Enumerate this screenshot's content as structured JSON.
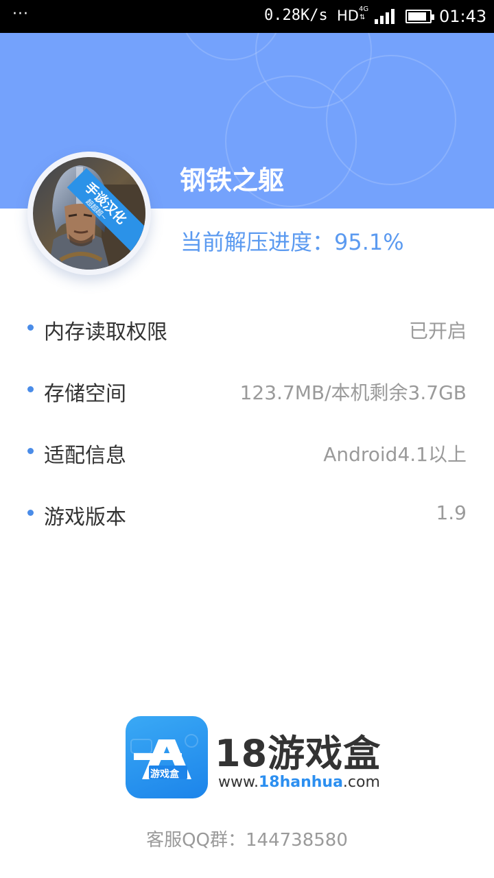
{
  "status_bar": {
    "menu": "···",
    "speed": "0.28K/s",
    "hd": "HD",
    "network": "4G",
    "net_arrows": "⇅",
    "battery_level": 0.85,
    "time": "01:43"
  },
  "header": {
    "title": "钢铁之躯",
    "progress_label": "当前解压进度：",
    "progress_value": "95.1%",
    "progress_fraction": 0.951
  },
  "avatar": {
    "badge_text": "手谈汉化",
    "badge_sub": "超超超~"
  },
  "info": [
    {
      "label": "内存读取权限",
      "value": "已开启"
    },
    {
      "label": "存储空间",
      "value": "123.7MB/本机剩余3.7GB"
    },
    {
      "label": "适配信息",
      "value": "Android4.1以上"
    },
    {
      "label": "游戏版本",
      "value": "1.9"
    }
  ],
  "brand": {
    "tile_text": "游戏盒",
    "name": "18游戏盒",
    "url_prefix": "www.",
    "url_domain": "18hanhua",
    "url_suffix": ".com"
  },
  "footer": {
    "qq_label": "客服QQ群：",
    "qq_number": "144738580"
  },
  "colors": {
    "header_bg": "#74a2fc",
    "progress_text": "#5b9af0",
    "bullet": "#4a8ce8",
    "brand_blue": "#2c8ff0"
  }
}
